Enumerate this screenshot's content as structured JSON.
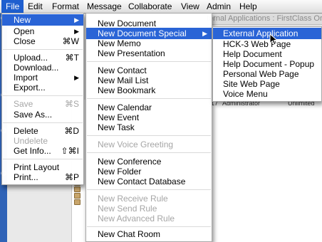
{
  "menubar": {
    "items": [
      {
        "label": "File",
        "active": true
      },
      {
        "label": "Edit"
      },
      {
        "label": "Format"
      },
      {
        "label": "Message"
      },
      {
        "label": "Collaborate"
      },
      {
        "label": "View"
      },
      {
        "label": "Admin"
      },
      {
        "label": "Help"
      }
    ]
  },
  "background": {
    "window_title": "ternal Applications : FirstClass Or",
    "row": {
      "col1": "17",
      "col2": "Administrator",
      "col3": "Unlimited"
    },
    "strip_letters": [
      "C",
      "O",
      "O",
      "O"
    ]
  },
  "file_menu": {
    "items": [
      {
        "label": "New",
        "arrow": "▶",
        "selected": true
      },
      {
        "label": "Open",
        "arrow": "▶"
      },
      {
        "label": "Close",
        "shortcut": "⌘W"
      },
      {
        "label": "Upload...",
        "shortcut": "⌘T"
      },
      {
        "label": "Download..."
      },
      {
        "label": "Import",
        "arrow": "▶"
      },
      {
        "label": "Export..."
      },
      {
        "label": "Save",
        "shortcut": "⌘S",
        "disabled": true
      },
      {
        "label": "Save As..."
      },
      {
        "label": "Delete",
        "shortcut": "⌘D"
      },
      {
        "label": "Undelete",
        "disabled": true
      },
      {
        "label": "Get Info...",
        "shortcut": "⇧⌘I"
      },
      {
        "label": "Print Layout"
      },
      {
        "label": "Print...",
        "shortcut": "⌘P"
      }
    ]
  },
  "new_menu": {
    "items": [
      {
        "label": "New Document"
      },
      {
        "label": "New Document Special",
        "arrow": "▶",
        "selected": true
      },
      {
        "label": "New Memo"
      },
      {
        "label": "New Presentation"
      },
      {
        "label": "New Contact"
      },
      {
        "label": "New Mail List"
      },
      {
        "label": "New Bookmark"
      },
      {
        "label": "New Calendar"
      },
      {
        "label": "New Event"
      },
      {
        "label": "New Task"
      },
      {
        "label": "New Voice Greeting",
        "disabled": true
      },
      {
        "label": "New Conference"
      },
      {
        "label": "New Folder"
      },
      {
        "label": "New Contact Database"
      },
      {
        "label": "New Receive Rule",
        "disabled": true
      },
      {
        "label": "New Send Rule",
        "disabled": true
      },
      {
        "label": "New Advanced Rule",
        "disabled": true
      },
      {
        "label": "New Chat Room"
      }
    ]
  },
  "special_menu": {
    "items": [
      {
        "label": "External Application",
        "selected": true
      },
      {
        "label": "HCK-3  Web Page"
      },
      {
        "label": "Help Document"
      },
      {
        "label": "Help Document - Popup"
      },
      {
        "label": "Personal Web Page"
      },
      {
        "label": "Site Web Page"
      },
      {
        "label": "Voice Menu"
      }
    ]
  },
  "colors": {
    "highlight": "#2a64d6",
    "menubar_active": "#1f5fcf",
    "disabled_text": "#a6a6a6"
  }
}
